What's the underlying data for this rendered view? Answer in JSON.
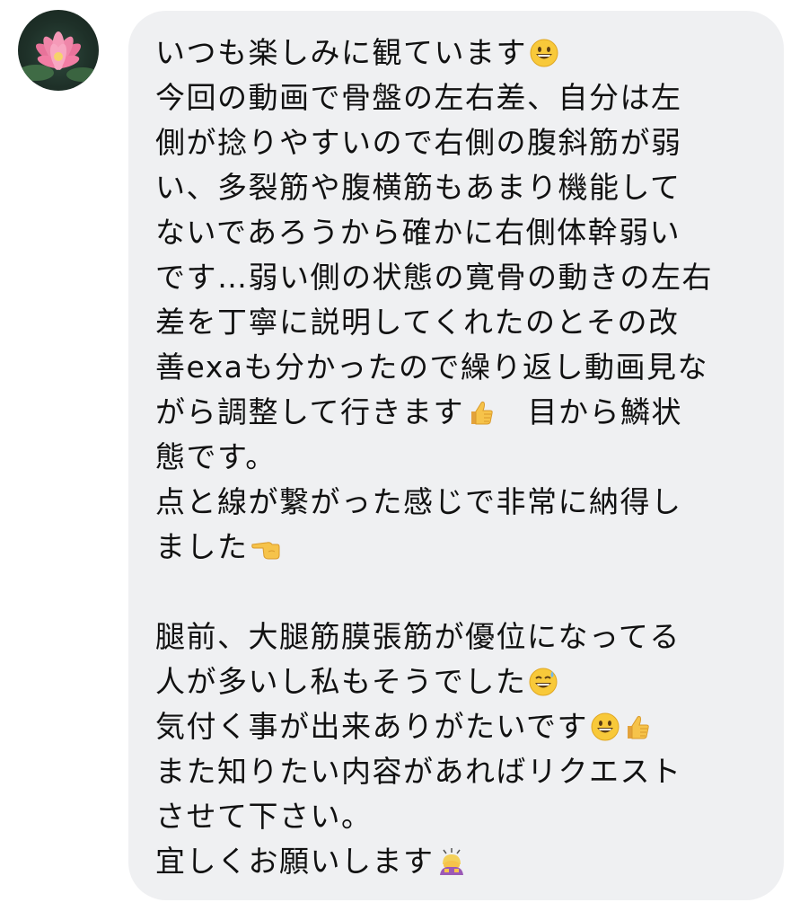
{
  "sender": {
    "avatar_icon": "lotus-flower-avatar-icon"
  },
  "message": {
    "lines": [
      "いつも楽しみに観ています",
      "今回の動画で骨盤の左右差、自分は左",
      "側が捻りやすいので右側の腹斜筋が弱",
      "い、多裂筋や腹横筋もあまり機能して",
      "ないであろうから確かに右側体幹弱い",
      "です…弱い側の状態の寛骨の動きの左右",
      "差を丁寧に説明してくれたのとその改",
      "善exaも分かったので繰り返し動画見な",
      "がら調整して行きます",
      "　目から鱗状",
      "態です。",
      "点と線が繋がった感じで非常に納得し",
      "ました",
      "腿前、大腿筋膜張筋が優位になってる",
      "人が多いし私もそうでした",
      "気付く事が出来ありがたいです",
      "また知りたい内容があればリクエスト",
      "させて下さい。",
      "宜しくお願いします"
    ],
    "emoji": {
      "grinning": "grinning-face-emoji",
      "thumbs_up": "thumbs-up-emoji",
      "pointing_left": "pointing-left-emoji",
      "sweat_smile": "grinning-face-with-sweat-emoji",
      "bowing": "bowing-person-emoji"
    }
  },
  "colors": {
    "bubble_bg": "#eff0f2",
    "text": "#111111"
  }
}
